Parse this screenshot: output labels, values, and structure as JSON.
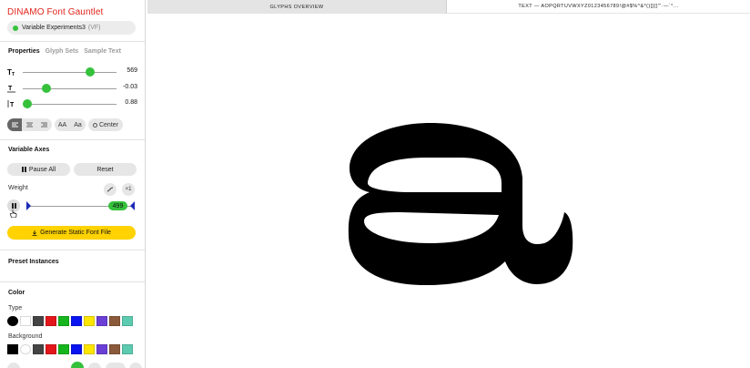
{
  "app": {
    "title": "DINAMO Font Gauntlet",
    "font_name": "Variable Experiments3",
    "font_badge": "(VF)"
  },
  "tabs": [
    {
      "label": "Properties",
      "active": true
    },
    {
      "label": "Glyph Sets",
      "active": false
    },
    {
      "label": "Sample Text",
      "active": false
    }
  ],
  "sliders": {
    "size": {
      "value": "569",
      "fraction": 0.72
    },
    "tracking": {
      "value": "-0.03",
      "fraction": 0.25
    },
    "leading": {
      "value": "0.88",
      "fraction": 0.05
    }
  },
  "alignment": {
    "case_upper": "AA",
    "case_mixed": "Aa",
    "center_label": "Center"
  },
  "variable_axes": {
    "title": "Variable Axes",
    "pause_all": "Pause All",
    "reset": "Reset",
    "axis_label": "Weight",
    "speed": "×1",
    "weight_value": "499"
  },
  "generate_label": "Generate Static Font File",
  "preset_title": "Preset Instances",
  "color": {
    "title": "Color",
    "type_label": "Type",
    "background_label": "Background",
    "type_swatches": [
      "#000000",
      "#ffffff",
      "#444444",
      "#e3171b",
      "#16b51e",
      "#0a14f0",
      "#ffe600",
      "#6a3fd6",
      "#8a5a3a",
      "#5ccbb0"
    ],
    "background_swatches": [
      "#000000",
      "#ffffff",
      "#444444",
      "#e3171b",
      "#16b51e",
      "#0a14f0",
      "#ffe600",
      "#6a3fd6",
      "#8a5a3a",
      "#5ccbb0"
    ]
  },
  "top_tabs": {
    "glyphs": "GLYPHS OVERVIEW",
    "text": "TEXT — AOPQRTUVWXYZ0123456789!@#$%^&*()[]{}\"'·—`°…"
  },
  "colors": {
    "brand_red": "#e1251b",
    "accent_green": "#35c13c",
    "generate_yellow": "#ffd200",
    "axis_marker_blue": "#1b2bb8"
  }
}
